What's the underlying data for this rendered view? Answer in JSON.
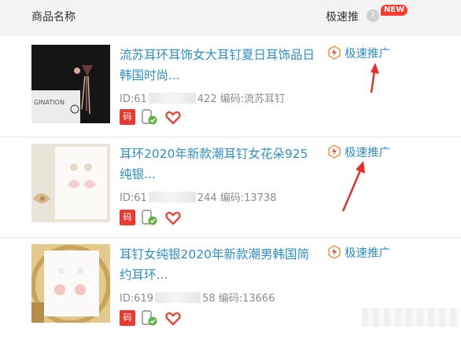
{
  "header": {
    "product_name_label": "商品名称",
    "speed_promo_label": "极速推",
    "help_glyph": "?",
    "new_badge": "NEW"
  },
  "icons": {
    "code_badge": "码",
    "colors": {
      "link": "#2f8ec9",
      "badge_red": "#e83a33",
      "new_red": "#ff3a2f",
      "promo_orange": "#f29136"
    }
  },
  "products": [
    {
      "title": "流苏耳环耳饰女大耳钉夏日耳饰品日韩国时尚...",
      "id_prefix": "ID:61",
      "id_suffix": "422",
      "code_label": "编码:流苏耳钉",
      "promo_label": "极速推广",
      "thumb_text": "GINATION"
    },
    {
      "title": "耳环2020年新款潮耳钉女花朵925纯银...",
      "id_prefix": "ID:61",
      "id_suffix": "244",
      "code_label": "编码:13738",
      "promo_label": "极速推广"
    },
    {
      "title": "耳钉女纯银2020年新款潮男韩国简约耳环...",
      "id_prefix": "ID:619",
      "id_suffix": "58",
      "code_label": "编码:13666",
      "promo_label": "极速推广"
    }
  ]
}
